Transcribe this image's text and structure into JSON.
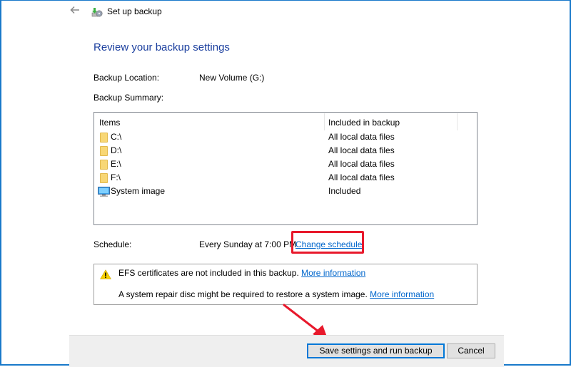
{
  "window": {
    "title": "Set up backup",
    "back_icon": "arrow-left-icon",
    "app_icon": "backup-icon"
  },
  "main": {
    "heading": "Review your backup settings",
    "backup_location_label": "Backup Location:",
    "backup_location_value": "New Volume (G:)",
    "backup_summary_label": "Backup Summary:",
    "summary_table": {
      "columns": [
        "Items",
        "Included in backup"
      ],
      "rows": [
        {
          "icon": "folder-icon",
          "item": "C:\\",
          "included": "All local data files"
        },
        {
          "icon": "folder-icon",
          "item": "D:\\",
          "included": "All local data files"
        },
        {
          "icon": "folder-icon",
          "item": "E:\\",
          "included": "All local data files"
        },
        {
          "icon": "folder-icon",
          "item": "F:\\",
          "included": "All local data files"
        },
        {
          "icon": "monitor-icon",
          "item": "System image",
          "included": "Included"
        }
      ]
    },
    "schedule_label": "Schedule:",
    "schedule_value": "Every Sunday at 7:00 PM",
    "change_schedule_link": "Change schedule",
    "info": {
      "icon": "warning-icon",
      "line1_text": "EFS certificates are not included in this backup.",
      "line1_link": "More information",
      "line2_text": "A system repair disc might be required to restore a system image.",
      "line2_link": "More information"
    }
  },
  "footer": {
    "primary_button": "Save settings and run backup",
    "cancel_button": "Cancel"
  },
  "annotations": {
    "highlight_color": "#e8192c",
    "arrow_color": "#e8192c"
  }
}
